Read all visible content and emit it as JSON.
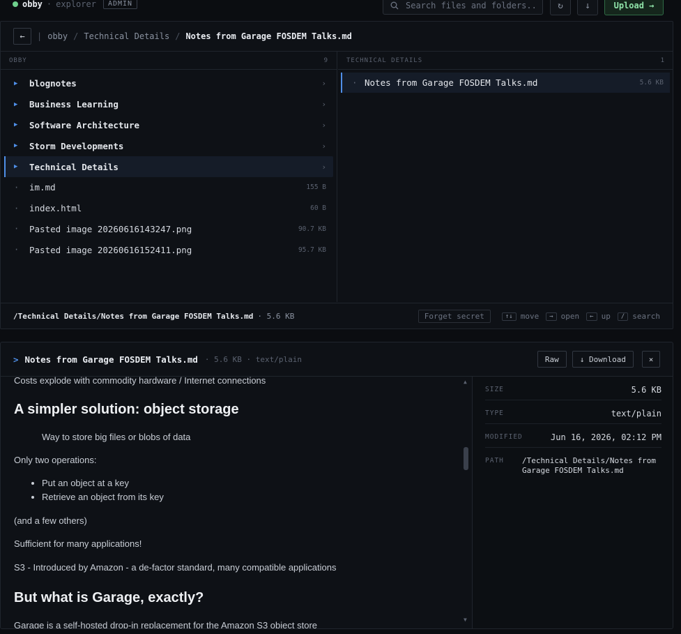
{
  "app": {
    "name": "obby",
    "section": "explorer",
    "role_badge": "ADMIN",
    "search_placeholder": "Search files and folders...",
    "refresh_icon": "refresh-icon",
    "download_icon": "download-icon",
    "upload_label": "Upload →"
  },
  "breadcrumb": {
    "back_label": "←",
    "separator": "/",
    "items": [
      "obby",
      "Technical Details"
    ],
    "current": "Notes from Garage FOSDEM Talks.md"
  },
  "left_column": {
    "header": "OBBY",
    "count": "9",
    "items": [
      {
        "name": "blognotes",
        "type": "folder"
      },
      {
        "name": "Business Learning",
        "type": "folder"
      },
      {
        "name": "Software Architecture",
        "type": "folder"
      },
      {
        "name": "Storm Developments",
        "type": "folder"
      },
      {
        "name": "Technical Details",
        "type": "folder",
        "selected": true
      },
      {
        "name": "im.md",
        "type": "file",
        "size": "155 B"
      },
      {
        "name": "index.html",
        "type": "file",
        "size": "60 B"
      },
      {
        "name": "Pasted image 20260616143247.png",
        "type": "file",
        "size": "90.7 KB"
      },
      {
        "name": "Pasted image 20260616152411.png",
        "type": "file",
        "size": "95.7 KB"
      }
    ]
  },
  "right_column": {
    "header": "TECHNICAL DETAILS",
    "count": "1",
    "items": [
      {
        "name": "Notes from Garage FOSDEM Talks.md",
        "size": "5.6 KB"
      }
    ]
  },
  "status": {
    "path": "/Technical Details/Notes from Garage FOSDEM Talks.md",
    "size": "· 5.6 KB",
    "forget_label": "Forget secret",
    "shortcuts": [
      {
        "key": "↑↓",
        "label": "move"
      },
      {
        "key": "→",
        "label": "open"
      },
      {
        "key": "←",
        "label": "up"
      },
      {
        "key": "/",
        "label": "search"
      }
    ]
  },
  "viewer": {
    "prompt": ">",
    "title": "Notes from Garage FOSDEM Talks.md",
    "meta": "· 5.6 KB · text/plain",
    "raw_label": "Raw",
    "download_label": "↓ Download",
    "close_label": "×",
    "content": {
      "p1": "Costs explode with commodity hardware / Internet connections",
      "h1": "A simpler solution: object storage",
      "quote": "Way to store big files or blobs of data",
      "p2": "Only two operations:",
      "list": [
        "Put an object at a key",
        "Retrieve an object from its key"
      ],
      "p3": "(and a few others)",
      "p4": "Sufficient for many applications!",
      "p5": "S3 - Introduced by Amazon - a de-factor standard, many compatible applications",
      "h2": "But what is Garage, exactly?",
      "p6": "Garage is a self-hosted drop-in replacement for the Amazon S3 object store"
    },
    "details": {
      "size_label": "SIZE",
      "size": "5.6 KB",
      "type_label": "TYPE",
      "type": "text/plain",
      "modified_label": "MODIFIED",
      "modified": "Jun 16, 2026, 02:12 PM",
      "path_label": "PATH",
      "path": "/Technical Details/Notes from Garage FOSDEM Talks.md"
    }
  },
  "colors": {
    "accent": "#4f8fe8",
    "success": "#6fcf8d",
    "background": "#0b0d11"
  }
}
